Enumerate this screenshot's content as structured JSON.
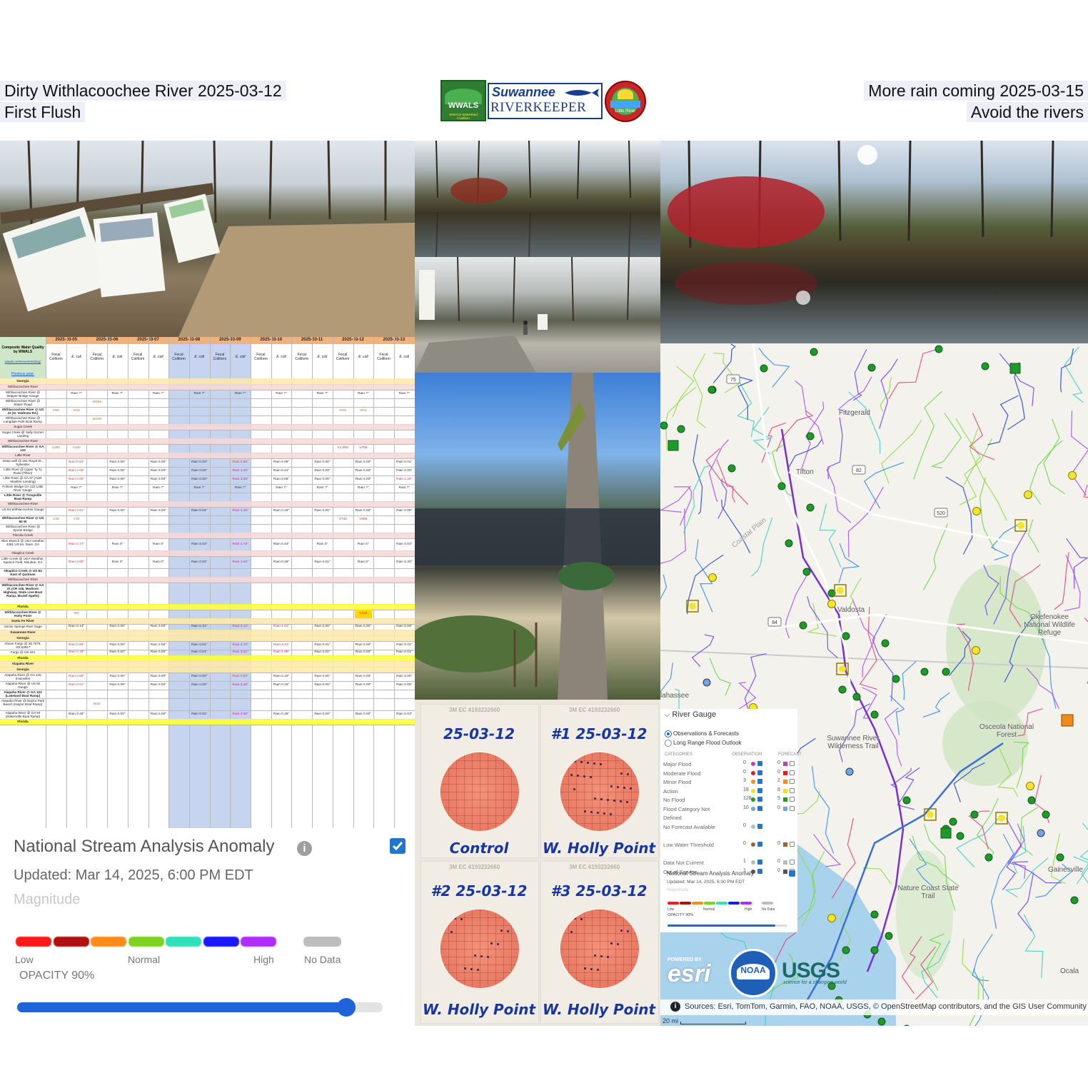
{
  "header": {
    "left_line1": "Dirty Withlacoochee River 2025-03-12",
    "left_line2": "First Flush",
    "right_line1": "More rain coming 2025-03-15",
    "right_line2": "Avoid the rivers"
  },
  "logos": {
    "wwals": "WWALS",
    "wwals_sub": "WWALS Watershed Coalition",
    "riverkeeper_top": "Suwannee",
    "riverkeeper_bottom": "RIVERKEEPER",
    "little_river": "Little River"
  },
  "table": {
    "corner_label": "Composite Water Quality by WWALS",
    "corner_link": "wwals.net/issues/testing/",
    "previous_year": "Previous year:",
    "dates": [
      "2025-03-05",
      "2025-03-06",
      "2025-03-07",
      "2025-03-08",
      "2025-03-09",
      "2025-03-10",
      "2025-03-11",
      "2025-03-12",
      "2025-03-13"
    ],
    "col_fecal": "Fecal Coliform",
    "col_ecoli": "E. coli",
    "rows": [
      {
        "label": "Georgia",
        "bold": true
      },
      {
        "label": "Withlacoochee River"
      },
      {
        "label": "Withlacoochee River @ Skipper Bridge Gauge",
        "vals": [
          "",
          "Rain ?\"",
          "",
          "Rain ?\"",
          "",
          "Rain ?\"",
          "",
          "Rain ?\"",
          "",
          "Rain ?\"",
          "",
          "Rain ?\"",
          "",
          "Rain ?\"",
          "",
          "Rain ?\"",
          "",
          "Rain ?\""
        ]
      },
      {
        "label": "Withlacoochee River @ Staten Road",
        "vals": [
          "",
          "",
          "W266",
          "",
          "",
          "",
          "",
          "",
          "",
          "",
          "",
          "",
          "",
          "",
          "",
          "",
          "",
          ""
        ]
      },
      {
        "label": "Withlacoochee River @ US 41 (N. Valdosta Rd.)",
        "bold": true,
        "vals": [
          "VNS",
          "VNS",
          "",
          "",
          "",
          "",
          "",
          "",
          "",
          "",
          "",
          "",
          "",
          "",
          "VNS",
          "VNS",
          "",
          ""
        ]
      },
      {
        "label": "Withlacoochee River @ Langdale Park Boat Ramp",
        "vals": [
          "",
          "",
          "W100",
          "",
          "",
          "",
          "",
          "",
          "",
          "",
          "",
          "",
          "",
          "",
          "",
          "",
          "",
          ""
        ]
      },
      {
        "label": "Sugar Creek"
      },
      {
        "label": "Sugar Creek @ Sally Corner Landing"
      },
      {
        "label": "Withlacoochee River"
      },
      {
        "label": "Withlacoochee River @ GA 133",
        "bold": true,
        "vals": [
          "V260",
          "V160",
          "",
          "",
          "",
          "",
          "",
          "",
          "",
          "",
          "",
          "",
          "",
          "",
          "V1,005",
          "V705",
          "",
          ""
        ]
      },
      {
        "label": "Little River"
      },
      {
        "label": "Deep well @ 161 Royal St., Sylvester",
        "vals": [
          "",
          "Rain 0.84\"",
          "",
          "Rain 0.00\"",
          "",
          "Rain 0.00\"",
          "",
          "Rain 0.00\"",
          "",
          "Rain 0.56\"",
          "",
          "Rain 0.06\"",
          "",
          "Rain 0.00\"",
          "",
          "Rain 0.00\"",
          "",
          "Rain 0.01\""
        ]
      },
      {
        "label": "Little River @ Upper Ty Ty Road (Tifton)",
        "vals": [
          "",
          "Rain 0.66\"",
          "",
          "Rain 0.00\"",
          "",
          "Rain 0.00\"",
          "",
          "Rain 0.00\"",
          "",
          "Rain 1.32\"",
          "",
          "Rain 0.21\"",
          "",
          "Rain 0.00\"",
          "",
          "Rain 0.00\"",
          "",
          "Rain 0.00\""
        ]
      },
      {
        "label": "Little River @ GA 37 (Adel-Moultrie Landing)",
        "vals": [
          "",
          "Rain 0.65\"",
          "",
          "Rain 0.00\"",
          "",
          "Rain 0.00\"",
          "",
          "Rain 0.00\"",
          "",
          "Rain 2.06\"",
          "",
          "Rain 0.06\"",
          "",
          "Rain 0.00\"",
          "",
          "Rain 0.00\"",
          "",
          "Rain 1.26\""
        ]
      },
      {
        "label": "Folsom Bridge GA 122 Little River Gauge",
        "vals": [
          "",
          "Rain ?\"",
          "",
          "Rain ?\"",
          "",
          "Rain ?\"",
          "",
          "Rain ?\"",
          "",
          "Rain ?\"",
          "",
          "Rain ?\"",
          "",
          "Rain ?\"",
          "",
          "Rain ?\"",
          "",
          "Rain ?\""
        ]
      },
      {
        "label": "Little River @ Troupville Boat Ramp",
        "bold": true
      },
      {
        "label": "Withlacoochee River"
      },
      {
        "label": "US 84 Withlacoochee Gauge",
        "vals": [
          "",
          "Rain 0.61\"",
          "",
          "Rain 0.00\"",
          "",
          "Rain 0.00\"",
          "",
          "Rain 0.04\"",
          "",
          "Rain 1.49\"",
          "",
          "Rain 0.19\"",
          "",
          "Rain 0.00\"",
          "",
          "Rain 0.00\"",
          "",
          "Rain 0.09\""
        ]
      },
      {
        "label": "Withlacoochee River @ US 84 W",
        "bold": true,
        "vals": [
          "V30",
          "V30",
          "",
          "",
          "",
          "",
          "",
          "",
          "",
          "",
          "",
          "",
          "",
          "",
          "V740",
          "V685",
          "",
          ""
        ]
      },
      {
        "label": "Withlacoochee River @ Spook Bridge"
      },
      {
        "label": "Piscola Creek"
      },
      {
        "label": "Allen Branch @ UGA weather, 4281 US 84, Dixie, GA",
        "vals": [
          "",
          "Rain 0.77\"",
          "",
          "Rain 0\"",
          "",
          "Rain 0\"",
          "",
          "Rain 0.02\"",
          "",
          "Rain 1.72\"",
          "",
          "Rain 0.44\"",
          "",
          "Rain 0\"",
          "",
          "Rain 0\"",
          "",
          "Rain 0.03\""
        ]
      },
      {
        "label": "Okapilco Creek"
      },
      {
        "label": "Little Creek @ UGA Weather, Spence Field, Moultrie, GA",
        "vals": [
          "",
          "Rain 0.65\"",
          "",
          "Rain 0\"",
          "",
          "Rain 0\"",
          "",
          "Rain 0.02\"",
          "",
          "Rain 1.82\"",
          "",
          "Rain 0.26\"",
          "",
          "Rain 0.01\"",
          "",
          "Rain 0\"",
          "",
          "Rain 0.30\""
        ]
      },
      {
        "label": "Okapilco Creek @ US 84 East of Quitman",
        "bold": true
      },
      {
        "label": "Withlacoochee River"
      },
      {
        "label": "Withlacoochee River @ GA 31 (CR 145, Madison Highway, State Line Boat Ramp, Mozell Spells)",
        "bold": true
      },
      {
        "label": "Florida",
        "bold": true
      },
      {
        "label": "Withlacoochee River @ Holly Point",
        "bold": true,
        "vals": [
          "",
          "W0",
          "",
          "",
          "",
          "",
          "",
          "",
          "",
          "",
          "",
          "",
          "",
          "",
          "",
          "V433",
          "",
          ""
        ]
      },
      {
        "label": "Santa Fe River",
        "bold": true
      },
      {
        "label": "Ginnie Springs Rain Gage",
        "vals": [
          "",
          "Rain 0.14\"",
          "",
          "Rain 0.00\"",
          "",
          "Rain 0.00\"",
          "",
          "Rain 0.31\"",
          "",
          "Rain 3.14\"",
          "",
          "Rain 1.01\"",
          "",
          "Rain 0.00\"",
          "",
          "Rain 0.00\"",
          "",
          "Rain 0.00\""
        ]
      },
      {
        "label": "Suwannee River",
        "bold": true
      },
      {
        "label": "Georgia",
        "bold": true
      },
      {
        "label": "Above Fargo @ 30.7075, -82.53917",
        "vals": [
          "",
          "Rain 0.86\"",
          "",
          "Rain 0.00\"",
          "",
          "Rain 0.00\"",
          "",
          "Rain 0.01\"",
          "",
          "Rain 2.70\"",
          "",
          "Rain 2.21\"",
          "",
          "Rain 0.01\"",
          "",
          "Rain 0.00\"",
          "",
          "Rain 0.01\""
        ]
      },
      {
        "label": "Fargo @ US 441",
        "vals": [
          "",
          "Rain 0.79\"",
          "",
          "Rain 0.00\"",
          "",
          "Rain 0.00\"",
          "",
          "Rain 0.01\"",
          "",
          "Rain 3.21\"",
          "",
          "Rain 1.06\"",
          "",
          "Rain 0.00\"",
          "",
          "Rain 0.00\"",
          "",
          "Rain 0.01\""
        ]
      },
      {
        "label": "Florida",
        "bold": true
      },
      {
        "label": "Alapaha River",
        "bold": true
      },
      {
        "label": "Georgia",
        "bold": true
      },
      {
        "label": "Alapaha River @ GA 125 (Irwinville)",
        "vals": [
          "",
          "Rain 0.68\"",
          "",
          "Rain 0.00\"",
          "",
          "Rain 0.00\"",
          "",
          "Rain 0.00\"",
          "",
          "Rain 0.83\"",
          "",
          "Rain 0.16\"",
          "",
          "Rain 0.00\"",
          "",
          "Rain 0.00\"",
          "",
          "Rain 0.00\""
        ]
      },
      {
        "label": "Alapaha River @ US 82 Gauge",
        "vals": [
          "",
          "Rain 0.61\"",
          "",
          "Rain 0.00\"",
          "",
          "Rain 0.00\"",
          "",
          "Rain 0.00\"",
          "",
          "Rain 2.48\"",
          "",
          "Rain 0.15\"",
          "",
          "Rain 0.00\"",
          "",
          "Rain 0.00\"",
          "",
          "Rain 0.09\""
        ]
      },
      {
        "label": "Alapaha River @ GA 122 (Lakeland Boat Ramp)",
        "bold": true
      },
      {
        "label": "Alapaha River @ Naylor Park Beach (Naylor Boat Ramp)",
        "vals": [
          "",
          "",
          "W33",
          "",
          "",
          "",
          "",
          "",
          "",
          "",
          "",
          "",
          "",
          "",
          "",
          "",
          "",
          ""
        ]
      },
      {
        "label": "Alapaha River @ GA 94 (Statenville Boat Ramp)",
        "vals": [
          "",
          "Rain 0.48\"",
          "",
          "Rain 0.00\"",
          "",
          "Rain 0.00\"",
          "",
          "Rain 0.01\"",
          "",
          "Rain 2.08\"",
          "",
          "Rain 0.35\"",
          "",
          "Rain 0.00\"",
          "",
          "Rain 0.00\"",
          "",
          "Rain 0.03\""
        ]
      },
      {
        "label": "Florida",
        "bold": true
      }
    ]
  },
  "anomaly_legend": {
    "title": "National Stream Analysis Anomaly",
    "updated": "Updated: Mar 14, 2025, 6:00 PM EDT",
    "magnitude": "Magnitude",
    "low": "Low",
    "normal": "Normal",
    "high": "High",
    "no_data": "No Data",
    "opacity": "OPACITY 90%",
    "opacity_value": 0.9,
    "checked": true,
    "colors": [
      "#ff1a1a",
      "#b01010",
      "#ff8c1a",
      "#7ed321",
      "#2fe0b8",
      "#1a1aff",
      "#b02cff"
    ],
    "nodata_color": "#bdbdbd"
  },
  "plates": [
    {
      "date": "25-03-12",
      "label": "Control",
      "brand": "3M EC 4193232660"
    },
    {
      "date": "#1 25-03-12",
      "label": "W. Holly Point",
      "brand": "3M EC 4193232660"
    },
    {
      "date": "#2 25-03-12",
      "label": "W. Holly Point",
      "brand": "3M EC 4193232660"
    },
    {
      "date": "#3 25-03-12",
      "label": "W. Holly Point",
      "brand": "3M EC 4193232660"
    }
  ],
  "map": {
    "places": [
      "Fitzgerald",
      "Tifton",
      "Valdosta",
      "Okefenokee National Wildlife Refuge",
      "Osceola National Forest",
      "Suwannee River Wilderness Trail",
      "Nature Coast State Trail",
      "Gainesville",
      "Ocala",
      "Coastal Plain",
      "lahassee"
    ],
    "roads": [
      "75",
      "82",
      "520",
      "84"
    ],
    "attribution": "Sources: Esri, TomTom, Garmin, FAO, NOAA, USGS, © OpenStreetMap contributors, and the GIS User Community",
    "scale": "20 mi",
    "logos": [
      "esri",
      "NOAA",
      "USGS"
    ],
    "usgs_tagline": "science for a changing world",
    "esri_powered": "POWERED BY"
  },
  "gauge_panel": {
    "title": "River Gauge",
    "option1": "Observations & Forecasts",
    "option2": "Long Range Flood Outlook",
    "categories_head": "CATEGORIES",
    "observation_head": "OBSERVATION",
    "forecast_head": "FORECAST",
    "categories": [
      {
        "name": "Major Flood",
        "obs": "0",
        "fc": "0",
        "color": "#c040c0"
      },
      {
        "name": "Moderate Flood",
        "obs": "0",
        "fc": "0",
        "color": "#e02020"
      },
      {
        "name": "Minor Flood",
        "obs": "3",
        "fc": "2",
        "color": "#ff8c1a"
      },
      {
        "name": "Action",
        "obs": "18",
        "fc": "8",
        "color": "#f0e020"
      },
      {
        "name": "No Flood",
        "obs": "128",
        "fc": "5",
        "color": "#20a020"
      },
      {
        "name": "Flood Category Not Defined",
        "obs": "10",
        "fc": "0",
        "color": "#6fa8dc"
      },
      {
        "name": "No Forecast Available",
        "obs": "0",
        "fc": "",
        "color": "#a0c0e0"
      },
      {
        "name": "Low Water Threshold",
        "obs": "0",
        "fc": "0",
        "color": "#a06030"
      },
      {
        "name": "Data Not Current",
        "obs": "1",
        "fc": "0",
        "color": "#bbbbbb"
      },
      {
        "name": "Out of Service",
        "obs": "1",
        "fc": "0",
        "color": "#555555"
      }
    ],
    "nsa_title": "National Stream Analysis Anomaly",
    "nsa_updated": "Updated: Mar 14, 2025, 6:00 PM EDT",
    "nsa_magnitude": "Magnitude",
    "low": "Low",
    "normal": "Normal",
    "high": "High",
    "no_data": "No Data",
    "opacity": "OPACITY 90%"
  }
}
